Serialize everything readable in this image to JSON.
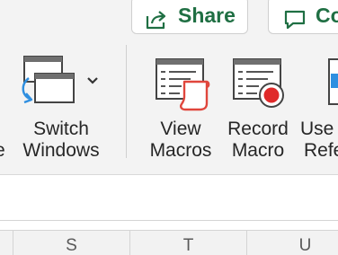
{
  "top_actions": {
    "share": {
      "icon": "share-icon",
      "label": "Share"
    },
    "comments": {
      "icon": "comment-icon",
      "label": "Co"
    }
  },
  "commands": {
    "switch_windows": {
      "icon": "switch-windows-icon",
      "line1": "Switch",
      "line2": "Windows",
      "partial_left": "e"
    },
    "view_macros": {
      "icon": "view-macros-icon",
      "line1": "View",
      "line2": "Macros"
    },
    "record_macro": {
      "icon": "record-macro-icon",
      "line1": "Record",
      "line2": "Macro"
    },
    "use_relative": {
      "icon": "use-relative-references-icon",
      "line1": "Use",
      "line2": "Refe"
    }
  },
  "columns": [
    "S",
    "T",
    "U"
  ],
  "colors": {
    "share_green": "#1f6f43",
    "record_red": "#e02a2a",
    "macro_red": "#e0463c",
    "accent_blue": "#2f8fe0"
  }
}
